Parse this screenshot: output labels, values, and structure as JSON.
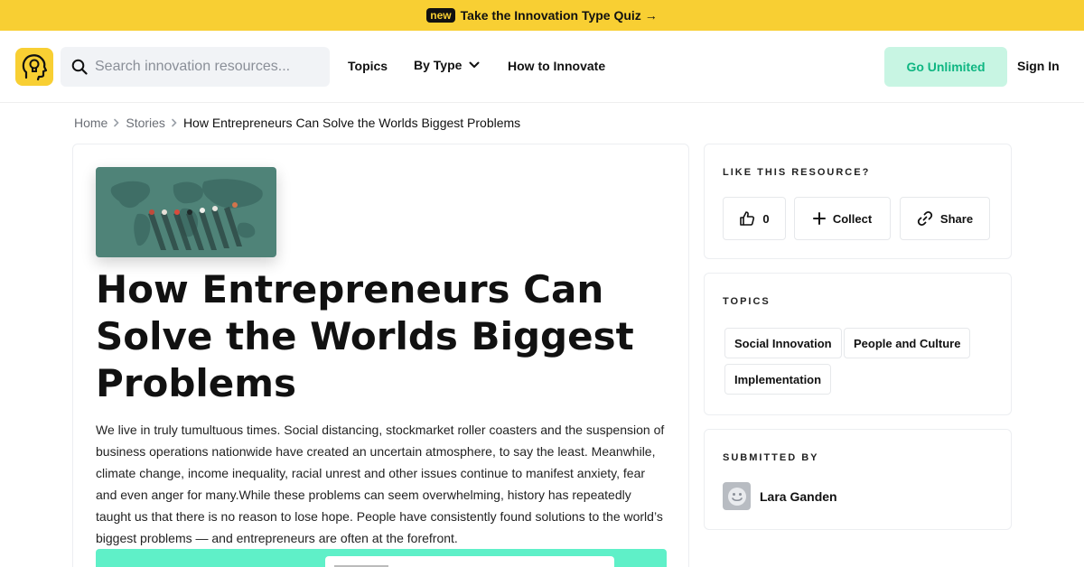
{
  "banner": {
    "badge": "new",
    "text": "Take the Innovation Type Quiz →"
  },
  "nav": {
    "search_placeholder": "Search innovation resources...",
    "links": {
      "topics": "Topics",
      "by_type": "By Type",
      "how_to": "How to Innovate"
    },
    "unlimited": "Go Unlimited",
    "sign_in": "Sign In"
  },
  "breadcrumb": {
    "home": "Home",
    "stories": "Stories",
    "current": "How Entrepreneurs Can Solve the Worlds Biggest Problems"
  },
  "article": {
    "title": "How Entrepreneurs Can Solve the Worlds Biggest Problems",
    "body": "We live in truly tumultuous times. Social distancing, stockmarket roller coasters and the suspension of business operations nationwide have created an uncertain atmosphere, to say the least. Meanwhile, climate change, income inequality, racial unrest and other issues continue to manifest anxiety, fear and even anger for many.While these problems can seem overwhelming, history has repeatedly taught us that there is no reason to lose hope. People have consistently found solutions to the world’s biggest problems — and entrepreneurs are often at the forefront."
  },
  "like_card": {
    "title": "LIKE THIS RESOURCE?",
    "likes": "0",
    "collect": "Collect",
    "share": "Share"
  },
  "topics_card": {
    "title": "TOPICS",
    "tags": [
      "Social Innovation",
      "People and Culture",
      "Implementation"
    ]
  },
  "submitted_card": {
    "title": "SUBMITTED BY",
    "author": "Lara Ganden"
  },
  "colors": {
    "banner": "#f8cf33",
    "accent": "#0fb682",
    "accent_bg": "#c8f5e3",
    "teal": "#5ff0c8"
  },
  "icons": [
    "search-icon",
    "lightbulb-head-logo-icon",
    "chevron-down-icon",
    "chevron-right-icon",
    "thumbs-up-icon",
    "plus-icon",
    "link-icon",
    "smiley-avatar-icon"
  ]
}
